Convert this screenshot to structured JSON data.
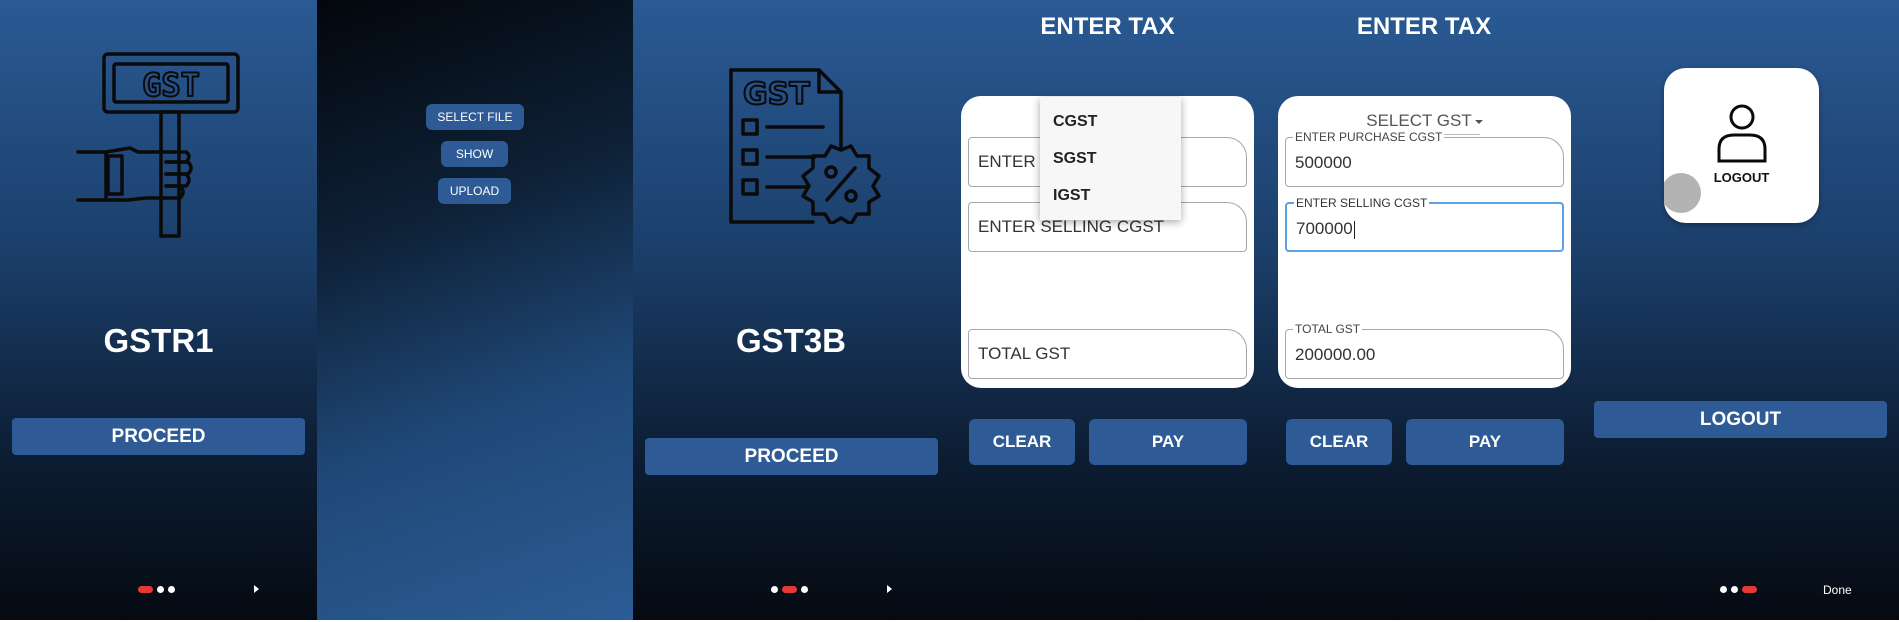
{
  "screens": {
    "gstr1": {
      "icon": "gst-sign-icon",
      "sign_text": "GST",
      "title": "GSTR1",
      "proceed_label": "PROCEED",
      "dots_active_index": 0
    },
    "upload": {
      "select_file_label": "SELECT FILE",
      "show_label": "SHOW",
      "upload_label": "UPLOAD"
    },
    "gst3b": {
      "icon": "gst-document-icon",
      "doc_text": "GST",
      "title": "GST3B",
      "proceed_label": "PROCEED",
      "dots_active_index": 1
    },
    "enter_tax_dropdown": {
      "header": "ENTER TAX",
      "purchase_placeholder_visible": "ENTER P",
      "selling_placeholder": "ENTER SELLING CGST",
      "total_placeholder": "TOTAL GST",
      "dropdown_options": [
        "CGST",
        "SGST",
        "IGST"
      ],
      "clear_label": "CLEAR",
      "pay_label": "PAY"
    },
    "enter_tax_filled": {
      "header": "ENTER TAX",
      "select_label": "SELECT GST",
      "purchase_label": "ENTER PURCHASE CGST",
      "purchase_value": "500000",
      "selling_label": "ENTER SELLING CGST",
      "selling_value": "700000",
      "total_label": "TOTAL GST",
      "total_value": "200000.00",
      "clear_label": "CLEAR",
      "pay_label": "PAY"
    },
    "logout": {
      "icon": "person-icon",
      "card_label": "LOGOUT",
      "button_label": "LOGOUT",
      "done_label": "Done",
      "dots_active_index": 2
    }
  },
  "colors": {
    "accent_button": "#2e5b96",
    "active_dot": "#e53935",
    "focus_border": "#5aa0e6"
  }
}
